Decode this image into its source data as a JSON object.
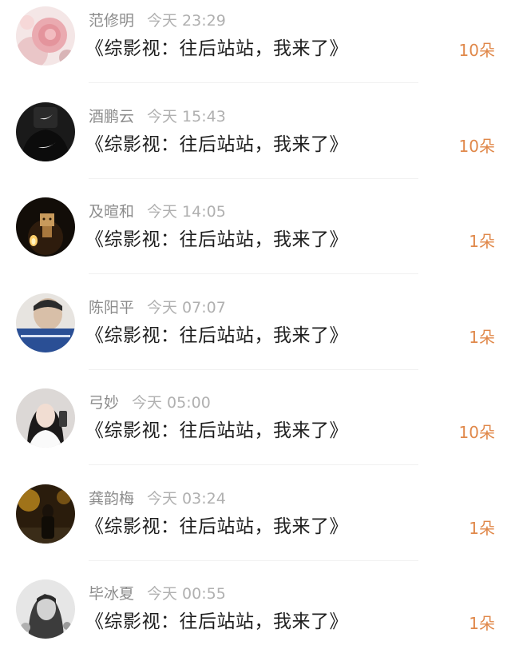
{
  "colors": {
    "name": "#8c8c8c",
    "time": "#b0b0b0",
    "title": "#1e1e1e",
    "gift": "#e0884a",
    "divider": "#f1f1f1"
  },
  "items": [
    {
      "user": "范修明",
      "time": "今天 23:29",
      "title": "《综影视：往后站站，我来了》",
      "gifts": "10朵",
      "avatar": "pink-rose-avatar"
    },
    {
      "user": "酒鹏云",
      "time": "今天 15:43",
      "title": "《综影视：往后站站，我来了》",
      "gifts": "10朵",
      "avatar": "black-shirt-avatar"
    },
    {
      "user": "及暄和",
      "time": "今天 14:05",
      "title": "《综影视：往后站站，我来了》",
      "gifts": "1朵",
      "avatar": "candle-figure-avatar"
    },
    {
      "user": "陈阳平",
      "time": "今天 07:07",
      "title": "《综影视：往后站站，我来了》",
      "gifts": "1朵",
      "avatar": "boy-portrait-avatar"
    },
    {
      "user": "弓妙",
      "time": "今天 05:00",
      "title": "《综影视：往后站站，我来了》",
      "gifts": "10朵",
      "avatar": "girl-selfie-avatar"
    },
    {
      "user": "龚韵梅",
      "time": "今天 03:24",
      "title": "《综影视：往后站站，我来了》",
      "gifts": "1朵",
      "avatar": "night-street-avatar"
    },
    {
      "user": "毕冰夏",
      "time": "今天 00:55",
      "title": "《综影视：往后站站，我来了》",
      "gifts": "1朵",
      "avatar": "sketch-girl-avatar"
    }
  ]
}
